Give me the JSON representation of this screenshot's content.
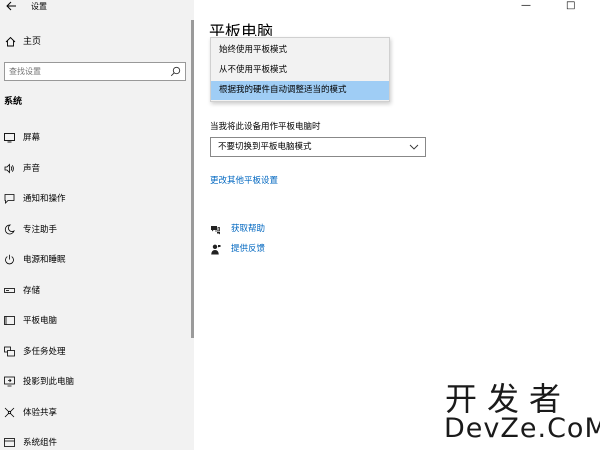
{
  "window": {
    "title": "设置",
    "controls": {
      "minimize": "—",
      "maximize": "□"
    }
  },
  "sidebar": {
    "home_label": "主页",
    "search": {
      "placeholder": "查找设置"
    },
    "section_heading": "系统",
    "items": [
      {
        "label": "屏幕",
        "icon": "monitor-icon"
      },
      {
        "label": "声音",
        "icon": "speaker-icon"
      },
      {
        "label": "通知和操作",
        "icon": "notification-icon"
      },
      {
        "label": "专注助手",
        "icon": "moon-icon"
      },
      {
        "label": "电源和睡眠",
        "icon": "power-icon"
      },
      {
        "label": "存储",
        "icon": "storage-icon"
      },
      {
        "label": "平板电脑",
        "icon": "tablet-icon"
      },
      {
        "label": "多任务处理",
        "icon": "multitask-icon"
      },
      {
        "label": "投影到此电脑",
        "icon": "project-icon"
      },
      {
        "label": "体验共享",
        "icon": "share-icon"
      },
      {
        "label": "系统组件",
        "icon": "components-icon"
      }
    ]
  },
  "main": {
    "page_title": "平板电脑",
    "dropdown_menu": {
      "options": [
        "始终使用平板模式",
        "从不使用平板模式",
        "根据我的硬件自动调整适当的模式"
      ],
      "selected_index": 2
    },
    "field_label": "当我将此设备用作平板电脑时",
    "select_value": "不要切换到平板电脑模式",
    "link_more": "更改其他平板设置",
    "help_links": {
      "get_help": "获取帮助",
      "feedback": "提供反馈"
    }
  },
  "watermark": {
    "line1": "开发者",
    "line2": "DevZe.CoM"
  },
  "colors": {
    "accent": "#0067c0",
    "selected": "#9fcdf5",
    "sidebar_bg": "#f2f2f2"
  }
}
